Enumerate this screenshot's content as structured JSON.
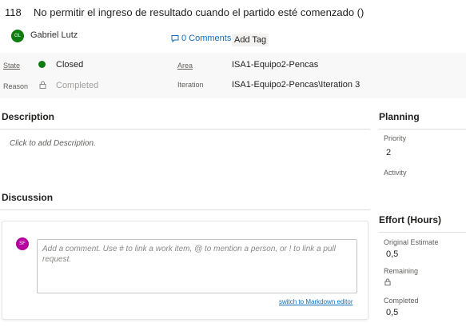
{
  "work_item": {
    "id": "118",
    "title": "No permitir el ingreso de resultado cuando el partido esté comenzado ()",
    "assignee": {
      "initials": "GL",
      "name": "Gabriel Lutz",
      "color": "#107c10"
    },
    "comments_label": "0 Comments",
    "add_tag_label": "Add Tag"
  },
  "fields": {
    "state": {
      "label": "State",
      "value": "Closed",
      "color": "#107c10"
    },
    "reason": {
      "label": "Reason",
      "value": "Completed",
      "icon": "lock-icon"
    },
    "area": {
      "label": "Area",
      "value": "ISA1-Equipo2-Pencas"
    },
    "iteration": {
      "label": "Iteration",
      "value": "ISA1-Equipo2-Pencas\\Iteration 3"
    }
  },
  "description": {
    "title": "Description",
    "placeholder": "Click to add Description."
  },
  "discussion": {
    "title": "Discussion",
    "user_initials": "SF",
    "user_color": "#b4009e",
    "placeholder": "Add a comment. Use # to link a work item, @ to mention a person, or ! to link a pull request.",
    "markdown_link": "switch to Markdown editor"
  },
  "planning": {
    "title": "Planning",
    "priority_label": "Priority",
    "priority_value": "2",
    "activity_label": "Activity"
  },
  "effort": {
    "title": "Effort (Hours)",
    "original_label": "Original Estimate",
    "original_value": "0,5",
    "remaining_label": "Remaining",
    "remaining_icon": "lock-icon",
    "completed_label": "Completed",
    "completed_value": "0,5"
  }
}
